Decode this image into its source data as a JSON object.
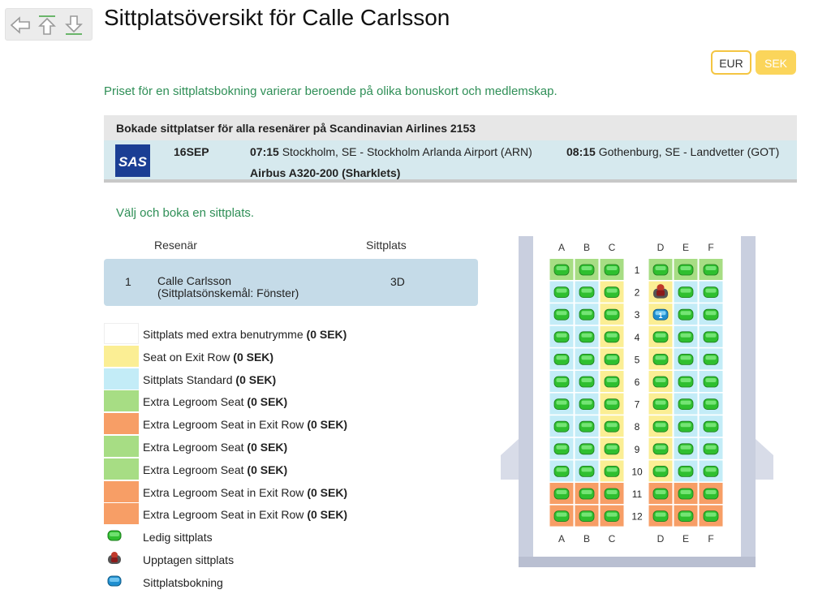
{
  "title": "Sittplatsöversikt för Calle Carlsson",
  "currency": {
    "options": [
      "EUR",
      "SEK"
    ],
    "selected": "SEK"
  },
  "price_note": "Priset för en sittplatsbokning varierar beroende på olika bonuskort och medlemskap.",
  "booking": {
    "header": "Bokade sittplatser för alla resenärer på Scandinavian Airlines 2153",
    "airline_logo": "SAS",
    "date": "16SEP",
    "dep_time": "07:15",
    "dep_place": "Stockholm, SE - Stockholm Arlanda Airport (ARN)",
    "arr_time": "08:15",
    "arr_place": "Gothenburg, SE - Landvetter (GOT)",
    "aircraft": "Airbus A320-200 (Sharklets)"
  },
  "choose_text": "Välj och boka en sittplats.",
  "passengers": {
    "col_passenger": "Resenär",
    "col_seat": "Sittplats",
    "rows": [
      {
        "no": "1",
        "name": "Calle Carlsson",
        "pref": "(Sittplatsönskemål: Fönster)",
        "seat": "3D"
      }
    ]
  },
  "legend": [
    {
      "label": "Sittplats med extra benutrymme",
      "price": "(0 SEK)",
      "color": "#ffffff"
    },
    {
      "label": "Seat on Exit Row",
      "price": "(0 SEK)",
      "color": "#fbee94"
    },
    {
      "label": "Sittplats Standard",
      "price": "(0 SEK)",
      "color": "#c3ecf7"
    },
    {
      "label": "Extra Legroom Seat",
      "price": "(0 SEK)",
      "color": "#a7dd84"
    },
    {
      "label": "Extra Legroom Seat in Exit Row",
      "price": "(0 SEK)",
      "color": "#f79e66"
    },
    {
      "label": "Extra Legroom Seat",
      "price": "(0 SEK)",
      "color": "#a7dd84"
    },
    {
      "label": "Extra Legroom Seat",
      "price": "(0 SEK)",
      "color": "#a7dd84"
    },
    {
      "label": "Extra Legroom Seat in Exit Row",
      "price": "(0 SEK)",
      "color": "#f79e66"
    },
    {
      "label": "Extra Legroom Seat in Exit Row",
      "price": "(0 SEK)",
      "color": "#f79e66"
    }
  ],
  "seat_legend": [
    {
      "label": "Ledig sittplats",
      "icon": "seat-available-icon"
    },
    {
      "label": "Upptagen sittplats",
      "icon": "seat-occupied-icon"
    },
    {
      "label": "Sittplatsbokning",
      "icon": "seat-booked-icon"
    }
  ],
  "seatmap": {
    "columns_left": [
      "A",
      "B",
      "C"
    ],
    "columns_right": [
      "D",
      "E",
      "F"
    ],
    "rows": [
      "1",
      "2",
      "3",
      "4",
      "5",
      "6",
      "7",
      "8",
      "9",
      "10",
      "11",
      "12"
    ],
    "row_classes": [
      "green",
      "standard",
      "standard",
      "standard",
      "standard",
      "standard",
      "standard",
      "standard",
      "standard",
      "standard",
      "orange",
      "orange"
    ],
    "occupied": [
      "2D"
    ],
    "booked": [
      {
        "seat": "3D",
        "label": "1"
      }
    ],
    "colors": {
      "green": "#a7dd84",
      "standard_blue": "#c3ecf7",
      "standard_yellow": "#fbee94",
      "orange": "#f79e66",
      "seat": "#2fbf2f",
      "booked": "#1f8fd0",
      "occupied": "#c0392b"
    }
  }
}
